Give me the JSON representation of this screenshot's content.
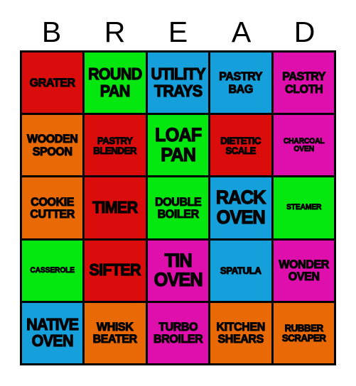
{
  "card": {
    "title_letters": [
      "B",
      "R",
      "E",
      "A",
      "D"
    ],
    "palette": {
      "red": "#DB0C0C",
      "green": "#04E810",
      "blue": "#16A0DB",
      "magenta": "#DF0FAD",
      "orange": "#E96A04",
      "border": "#000000",
      "text": "#000000",
      "background": "#FFFFFF"
    },
    "rows": [
      [
        {
          "label": "GRATER",
          "color": "#DB0C0C",
          "size": "md"
        },
        {
          "label": "ROUND\nPAN",
          "color": "#04E810",
          "size": "lg"
        },
        {
          "label": "UTILITY\nTRAYS",
          "color": "#16A0DB",
          "size": "lg"
        },
        {
          "label": "PASTRY\nBAG",
          "color": "#16A0DB",
          "size": "md"
        },
        {
          "label": "PASTRY\nCLOTH",
          "color": "#DF0FAD",
          "size": "md"
        }
      ],
      [
        {
          "label": "WOODEN\nSPOON",
          "color": "#E96A04",
          "size": "md"
        },
        {
          "label": "PASTRY\nBLENDER",
          "color": "#DB0C0C",
          "size": "sm"
        },
        {
          "label": "LOAF\nPAN",
          "color": "#04E810",
          "size": "xl"
        },
        {
          "label": "DIETETIC\nSCALE",
          "color": "#DB0C0C",
          "size": "sm"
        },
        {
          "label": "CHARCOAL\nOVEN",
          "color": "#DF0FAD",
          "size": "xs"
        }
      ],
      [
        {
          "label": "COOKIE\nCUTTER",
          "color": "#E96A04",
          "size": "md"
        },
        {
          "label": "TIMER",
          "color": "#DB0C0C",
          "size": "lg"
        },
        {
          "label": "DOUBLE\nBOILER",
          "color": "#04E810",
          "size": "md"
        },
        {
          "label": "RACK\nOVEN",
          "color": "#16A0DB",
          "size": "xl"
        },
        {
          "label": "STEAMER",
          "color": "#04E810",
          "size": "xs"
        }
      ],
      [
        {
          "label": "CASSEROLE",
          "color": "#04E810",
          "size": "xs"
        },
        {
          "label": "SIFTER",
          "color": "#DB0C0C",
          "size": "lg"
        },
        {
          "label": "TIN\nOVEN",
          "color": "#DF0FAD",
          "size": "xl"
        },
        {
          "label": "SPATULA",
          "color": "#16A0DB",
          "size": "sm"
        },
        {
          "label": "WONDER\nOVEN",
          "color": "#DF0FAD",
          "size": "md"
        }
      ],
      [
        {
          "label": "NATIVE\nOVEN",
          "color": "#16A0DB",
          "size": "lg"
        },
        {
          "label": "WHISK\nBEATER",
          "color": "#E96A04",
          "size": "md"
        },
        {
          "label": "TURBO\nBROILER",
          "color": "#DF0FAD",
          "size": "md"
        },
        {
          "label": "KITCHEN\nSHEARS",
          "color": "#E96A04",
          "size": "md"
        },
        {
          "label": "RUBBER\nSCRAPER",
          "color": "#E96A04",
          "size": "sm"
        }
      ]
    ]
  }
}
